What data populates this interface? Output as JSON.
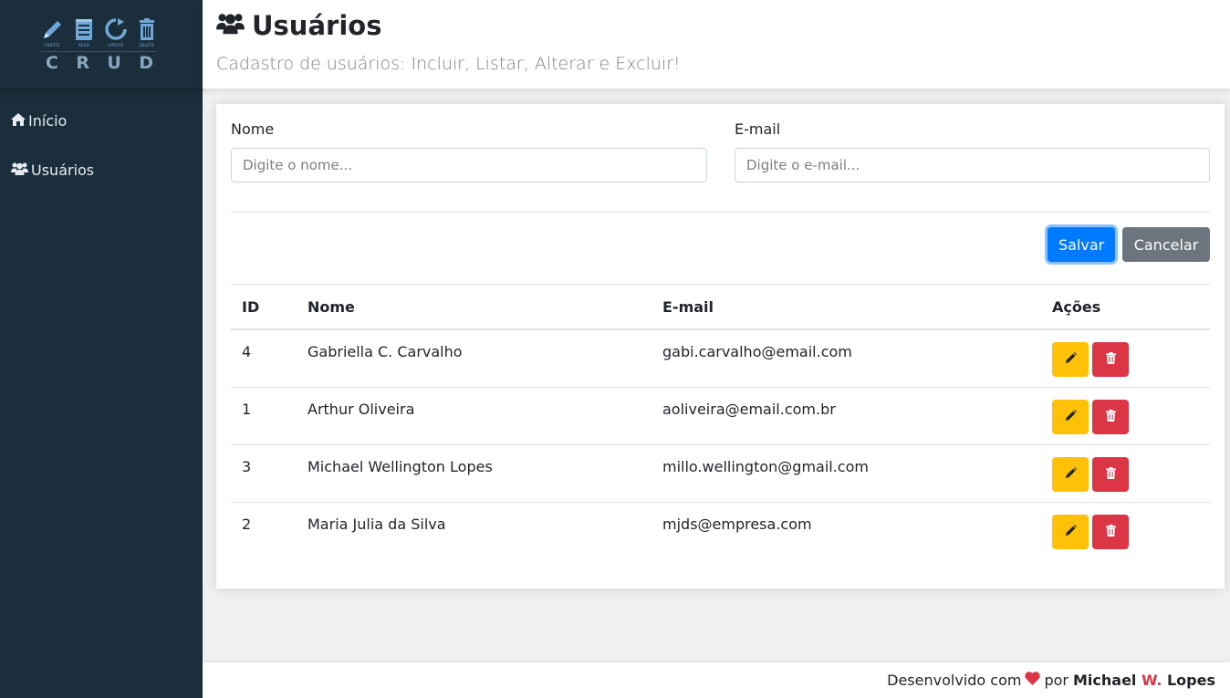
{
  "sidebar": {
    "logo": {
      "icons": [
        {
          "name": "create-pencil-icon",
          "caption": "CREATE"
        },
        {
          "name": "read-notepad-icon",
          "caption": "READ"
        },
        {
          "name": "update-refresh-icon",
          "caption": "UPDATE"
        },
        {
          "name": "delete-trash-icon",
          "caption": "DELETE"
        }
      ],
      "letters": [
        "C",
        "R",
        "U",
        "D"
      ]
    },
    "items": [
      {
        "label": "Início",
        "icon": "home-icon"
      },
      {
        "label": "Usuários",
        "icon": "users-icon"
      }
    ]
  },
  "header": {
    "title": "Usuários",
    "title_icon": "users-icon",
    "subtitle": "Cadastro de usuários: Incluir, Listar, Alterar e Excluir!"
  },
  "form": {
    "name_label": "Nome",
    "name_placeholder": "Digite o nome...",
    "name_value": "",
    "email_label": "E-mail",
    "email_placeholder": "Digite o e-mail...",
    "email_value": "",
    "save_label": "Salvar",
    "cancel_label": "Cancelar"
  },
  "table": {
    "headers": [
      "ID",
      "Nome",
      "E-mail",
      "Ações"
    ],
    "rows": [
      {
        "id": "4",
        "name": "Gabriella C. Carvalho",
        "email": "gabi.carvalho@email.com"
      },
      {
        "id": "1",
        "name": "Arthur Oliveira",
        "email": "aoliveira@email.com.br"
      },
      {
        "id": "3",
        "name": "Michael Wellington Lopes",
        "email": "millo.wellington@gmail.com"
      },
      {
        "id": "2",
        "name": "Maria Julia da Silva",
        "email": "mjds@empresa.com"
      }
    ]
  },
  "footer": {
    "prefix": "Desenvolvido com",
    "middle": "por",
    "author_first": "Michael",
    "author_middle": "W.",
    "author_last": "Lopes"
  },
  "colors": {
    "sidebar_bg": "#1b2e3c",
    "primary": "#007bff",
    "secondary": "#6c757d",
    "warning": "#ffc107",
    "danger": "#dc3545"
  }
}
